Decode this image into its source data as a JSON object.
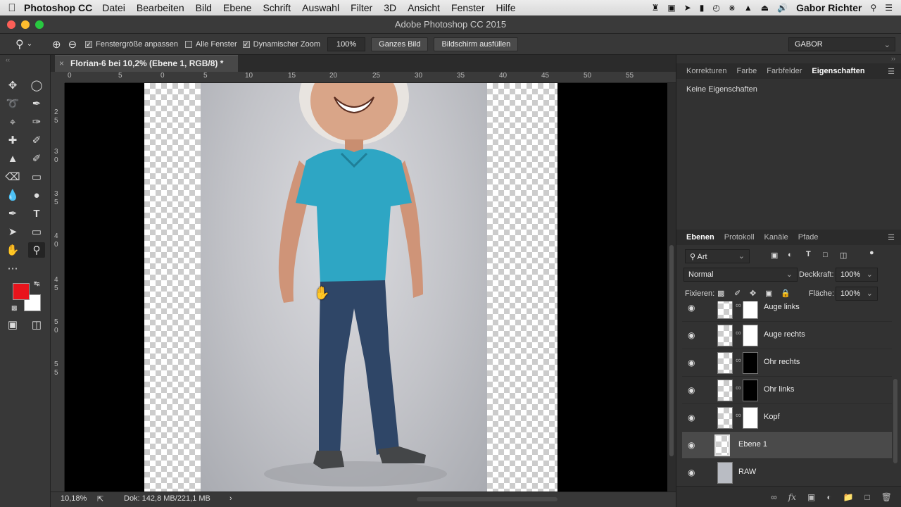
{
  "menubar": {
    "app_name": "Photoshop CC",
    "items": [
      "Datei",
      "Bearbeiten",
      "Bild",
      "Ebene",
      "Schrift",
      "Auswahl",
      "Filter",
      "3D",
      "Ansicht",
      "Fenster",
      "Hilfe"
    ],
    "user": "Gabor Richter"
  },
  "window": {
    "title": "Adobe Photoshop CC 2015"
  },
  "options": {
    "fit_window_label": "Fenstergröße anpassen",
    "fit_window_checked": true,
    "all_windows_label": "Alle Fenster",
    "all_windows_checked": false,
    "dynamic_zoom_label": "Dynamischer Zoom",
    "dynamic_zoom_checked": true,
    "zoom_value": "100%",
    "whole_image_button": "Ganzes Bild",
    "fill_screen_button": "Bildschirm ausfüllen",
    "workspace": "GABOR"
  },
  "document": {
    "tab_title": "Florian-6 bei 10,2% (Ebene 1, RGB/8) *",
    "close": "×"
  },
  "rulers": {
    "horizontal": [
      "0",
      "5",
      "0",
      "5",
      "10",
      "15",
      "20",
      "25",
      "30",
      "35",
      "40",
      "45",
      "50",
      "55"
    ],
    "vertical": [
      "2",
      "5",
      "3",
      "0",
      "3",
      "5",
      "4",
      "0",
      "4",
      "5",
      "5",
      "0",
      "5",
      "5"
    ]
  },
  "status": {
    "zoom": "10,18%",
    "doc_size": "Dok: 142,8 MB/221,1 MB"
  },
  "props_panel": {
    "tabs": [
      "Korrekturen",
      "Farbe",
      "Farbfelder",
      "Eigenschaften"
    ],
    "active_tab": "Eigenschaften",
    "message": "Keine Eigenschaften"
  },
  "layers_panel": {
    "tabs": [
      "Ebenen",
      "Protokoll",
      "Kanäle",
      "Pfade"
    ],
    "active_tab": "Ebenen",
    "filter_label": "Art",
    "blend_mode": "Normal",
    "opacity_label": "Deckkraft:",
    "opacity_value": "100%",
    "lock_label": "Fixieren:",
    "fill_label": "Fläche:",
    "fill_value": "100%",
    "layers": [
      {
        "name": "Auge links",
        "mask": "white",
        "selected": false
      },
      {
        "name": "Auge rechts",
        "mask": "white",
        "selected": false
      },
      {
        "name": "Ohr rechts",
        "mask": "black",
        "selected": false
      },
      {
        "name": "Ohr links",
        "mask": "black",
        "selected": false
      },
      {
        "name": "Kopf",
        "mask": "white",
        "selected": false
      },
      {
        "name": "Ebene 1",
        "mask": "none",
        "selected": true
      },
      {
        "name": "RAW",
        "mask": "none",
        "selected": false
      }
    ],
    "bottom_icons": [
      "link-icon",
      "fx-icon",
      "add-mask-icon",
      "adjustment-icon",
      "group-icon",
      "new-layer-icon",
      "trash-icon"
    ]
  },
  "colors": {
    "foreground": "#e8141c",
    "background": "#ffffff",
    "shirt": "#2ea6c4",
    "jeans": "#2f4667"
  }
}
